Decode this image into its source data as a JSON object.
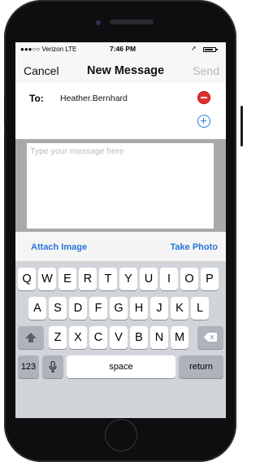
{
  "status_bar": {
    "carrier": "●●●○○ Verizon  LTE",
    "time": "7:46 PM",
    "location_icon": "➚"
  },
  "nav": {
    "cancel": "Cancel",
    "title": "New Message",
    "send": "Send"
  },
  "recipients": {
    "label": "To:",
    "name": "Heather.Bernhard"
  },
  "message": {
    "placeholder": "Type your message here",
    "value": ""
  },
  "attachments": {
    "attach_image": "Attach Image",
    "take_photo": "Take Photo"
  },
  "keyboard": {
    "row1": [
      "Q",
      "W",
      "E",
      "R",
      "T",
      "Y",
      "U",
      "I",
      "O",
      "P"
    ],
    "row2": [
      "A",
      "S",
      "D",
      "F",
      "G",
      "H",
      "J",
      "K",
      "L"
    ],
    "row3": [
      "Z",
      "X",
      "C",
      "V",
      "B",
      "N",
      "M"
    ],
    "numbers_key": "123",
    "space_key": "space",
    "return_key": "return"
  },
  "colors": {
    "accent": "#2a74d8",
    "remove": "#e0312f",
    "keyboard_bg": "#d1d4d9"
  }
}
